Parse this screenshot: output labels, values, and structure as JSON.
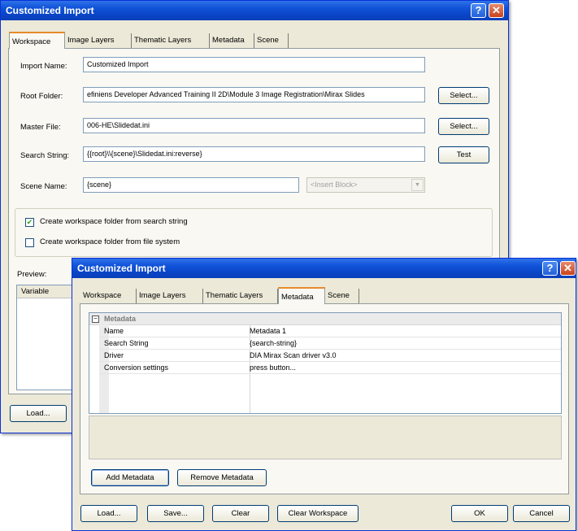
{
  "back_window": {
    "title": "Customized Import",
    "tabs": [
      "Workspace",
      "Image Layers",
      "Thematic Layers",
      "Metadata",
      "Scene"
    ],
    "fields": {
      "import_name": {
        "label": "Import Name:",
        "value": "Customized Import"
      },
      "root_folder": {
        "label": "Root Folder:",
        "value": "efiniens Developer Advanced Training II 2D\\Module 3 Image Registration\\Mirax Slides",
        "button": "Select..."
      },
      "master_file": {
        "label": "Master File:",
        "value": "006-HE\\Slidedat.ini",
        "button": "Select..."
      },
      "search_string": {
        "label": "Search String:",
        "value": "{{root}\\\\{scene}\\Slidedat.ini:reverse}",
        "button": "Test"
      },
      "scene_name": {
        "label": "Scene Name:",
        "value": "{scene}",
        "insert_placeholder": "<Insert Block>"
      }
    },
    "checkboxes": [
      {
        "label": "Create workspace folder from search string",
        "checked": true
      },
      {
        "label": "Create workspace folder from file system",
        "checked": false
      }
    ],
    "preview_label": "Preview:",
    "preview_column": "Variable",
    "load_button": "Load..."
  },
  "front_window": {
    "title": "Customized Import",
    "tabs": [
      "Workspace",
      "Image Layers",
      "Thematic Layers",
      "Metadata",
      "Scene"
    ],
    "active_tab": "Metadata",
    "metadata_group": "Metadata",
    "rows": [
      {
        "key": "Name",
        "value": "Metadata 1"
      },
      {
        "key": "Search String",
        "value": "{search-string}"
      },
      {
        "key": "Driver",
        "value": "DIA Mirax Scan driver v3.0"
      },
      {
        "key": "Conversion settings",
        "value": "press button..."
      }
    ],
    "add_button": "Add Metadata",
    "remove_button": "Remove Metadata",
    "footer_buttons": [
      "Load...",
      "Save...",
      "Clear",
      "Clear Workspace",
      "OK",
      "Cancel"
    ]
  }
}
